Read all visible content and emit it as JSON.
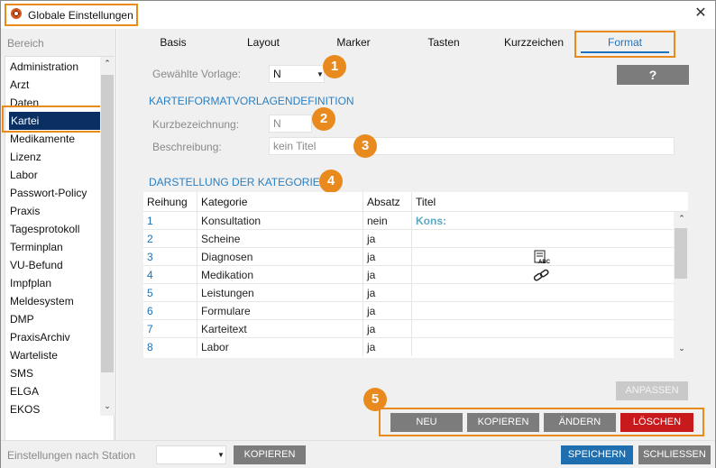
{
  "window": {
    "title": "Globale Einstellungen",
    "close_glyph": "✕"
  },
  "sidebar": {
    "label": "Bereich",
    "items": [
      "Administration",
      "Arzt",
      "Daten",
      "Kartei",
      "Medikamente",
      "Lizenz",
      "Labor",
      "Passwort-Policy",
      "Praxis",
      "Tagesprotokoll",
      "Terminplan",
      "VU-Befund",
      "Impfplan",
      "Meldesystem",
      "DMP",
      "PraxisArchiv",
      "Warteliste",
      "SMS",
      "ELGA",
      "EKOS"
    ],
    "selected": "Kartei",
    "scroll_up": "⌃",
    "scroll_down": "⌄"
  },
  "tabs": {
    "items": [
      "Basis",
      "Layout",
      "Marker",
      "Tasten",
      "Kurzzeichen",
      "Format"
    ],
    "active": "Format"
  },
  "form": {
    "vorlage_label": "Gewählte Vorlage:",
    "vorlage_value": "N",
    "help_label": "?",
    "section1": "KARTEIFORMATVORLAGENDEFINITION",
    "kurz_label": "Kurzbezeichnung:",
    "kurz_value": "N",
    "beschr_label": "Beschreibung:",
    "beschr_value": "kein Titel",
    "section2": "DARSTELLUNG DER KATEGORIEN"
  },
  "badges": [
    "1",
    "2",
    "3",
    "4",
    "5"
  ],
  "table": {
    "headers": [
      "Reihung",
      "Kategorie",
      "Absatz",
      "Titel"
    ],
    "rows": [
      {
        "reihung": "1",
        "kategorie": "Konsultation",
        "absatz": "nein",
        "titel": "Kons:"
      },
      {
        "reihung": "2",
        "kategorie": "Scheine",
        "absatz": "ja",
        "titel": ""
      },
      {
        "reihung": "3",
        "kategorie": "Diagnosen",
        "absatz": "ja",
        "titel": ""
      },
      {
        "reihung": "4",
        "kategorie": "Medikation",
        "absatz": "ja",
        "titel": ""
      },
      {
        "reihung": "5",
        "kategorie": "Leistungen",
        "absatz": "ja",
        "titel": ""
      },
      {
        "reihung": "6",
        "kategorie": "Formulare",
        "absatz": "ja",
        "titel": ""
      },
      {
        "reihung": "7",
        "kategorie": "Karteitext",
        "absatz": "ja",
        "titel": ""
      },
      {
        "reihung": "8",
        "kategorie": "Labor",
        "absatz": "ja",
        "titel": ""
      }
    ],
    "abc_icon_text": "ABC"
  },
  "buttons": {
    "anpassen": "ANPASSEN",
    "neu": "NEU",
    "kopieren": "KOPIEREN",
    "aendern": "ÄNDERN",
    "loeschen": "LÖSCHEN"
  },
  "footer": {
    "station_label": "Einstellungen nach Station",
    "kopieren": "KOPIEREN",
    "speichern": "SPEICHERN",
    "schliessen": "SCHLIESSEN"
  },
  "colors": {
    "highlight_orange": "#e98a1e",
    "selection_navy": "#0a2f63",
    "link_blue": "#1e6fb5",
    "delete_red": "#c8191d",
    "save_blue": "#1f6fb0"
  }
}
